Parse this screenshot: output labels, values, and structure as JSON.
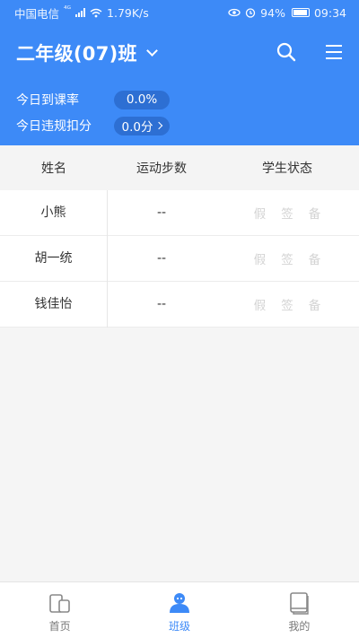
{
  "status_bar": {
    "carrier": "中国电信",
    "network": "⁴ᴳ",
    "speed": "1.79K/s",
    "battery": "94%",
    "time": "09:34"
  },
  "header": {
    "class_name": "二年级(07)班",
    "stats": [
      {
        "label": "今日到课率",
        "value": "0.0%"
      },
      {
        "label": "今日违规扣分",
        "value": "0.0分"
      }
    ]
  },
  "table": {
    "headers": [
      "姓名",
      "运动步数",
      "学生状态"
    ],
    "rows": [
      {
        "name": "小熊",
        "steps": "--",
        "states": [
          "假",
          "签",
          "备"
        ]
      },
      {
        "name": "胡一统",
        "steps": "--",
        "states": [
          "假",
          "签",
          "备"
        ]
      },
      {
        "name": "钱佳怡",
        "steps": "--",
        "states": [
          "假",
          "签",
          "备"
        ]
      }
    ]
  },
  "tabbar": {
    "tabs": [
      {
        "label": "首页",
        "icon": "home-icon",
        "active": false
      },
      {
        "label": "班级",
        "icon": "class-icon",
        "active": true
      },
      {
        "label": "我的",
        "icon": "profile-icon",
        "active": false
      }
    ],
    "active_color": "#3d8af7"
  },
  "colors": {
    "header_bg": "#3d8af7",
    "pill_bg": "#2d6fd3"
  }
}
